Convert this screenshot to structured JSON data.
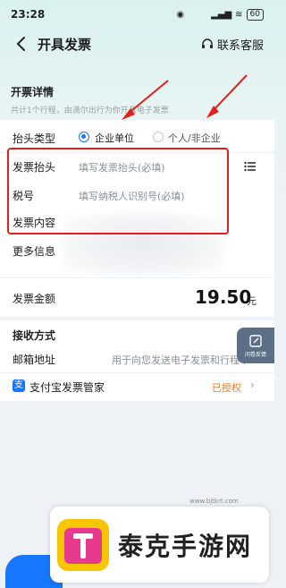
{
  "status_bar": {
    "time": "23:28",
    "battery": "60"
  },
  "nav": {
    "title": "开具发票",
    "service": "联系客服"
  },
  "details": {
    "section_title": "开票详情",
    "hint": "共计1个行程，由滴尔出行为你开具电子发票"
  },
  "header_type": {
    "label": "抬头类型",
    "options": [
      {
        "label": "企业单位",
        "selected": true
      },
      {
        "label": "个人/非企业",
        "selected": false
      }
    ]
  },
  "invoice_title": {
    "label": "发票抬头",
    "placeholder": "填写发票抬头(必填)"
  },
  "tax_id": {
    "label": "税号",
    "placeholder": "填写纳税人识别号(必填)"
  },
  "invoice_content": {
    "label": "发票内容"
  },
  "more_info": {
    "label": "更多信息"
  },
  "amount": {
    "label": "发票金额",
    "value": "19.50",
    "unit": "元"
  },
  "receive": {
    "section_title": "接收方式"
  },
  "email": {
    "label": "邮箱地址",
    "placeholder": "用于向您发送电子发票和行程单"
  },
  "alipay": {
    "label": "支付宝发票管家",
    "status": "已授权"
  },
  "feedback": {
    "label": "问卷反馈"
  },
  "watermark": {
    "text": "泰克手游网",
    "url": "www.bjtkrt.com"
  },
  "colors": {
    "accent": "#1677ff",
    "highlight_box": "#e0201e",
    "authorized": "#f07a1b"
  }
}
